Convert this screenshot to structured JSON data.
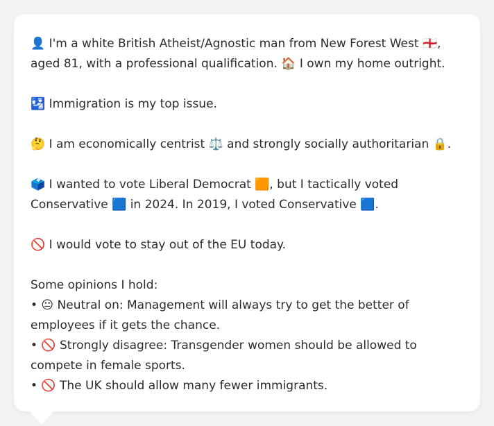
{
  "profile": {
    "intro": "👤 I'm a white British Atheist/Agnostic man from New Forest West 🏴󠁧󠁢󠁥󠁮󠁧󠁿, aged 81, with a professional qualification. 🏠 I own my home outright.",
    "top_issue": "🛂 Immigration is my top issue.",
    "economic": "🤔 I am economically centrist ⚖️ and strongly socially authoritarian 🔒.",
    "voting": "🗳️ I wanted to vote Liberal Democrat 🟧, but I tactically voted Conservative 🟦 in 2024. In 2019, I voted Conservative 🟦.",
    "eu": "🚫 I would vote to stay out of the EU today.",
    "opinions_heading": "Some opinions I hold:",
    "opinions": [
      "• 😐 Neutral on: Management will always try to get the better of employees if it gets the chance.",
      "• 🚫 Strongly disagree: Transgender women should be allowed to compete in female sports.",
      "• 🚫 The UK should allow many fewer immigrants."
    ]
  }
}
